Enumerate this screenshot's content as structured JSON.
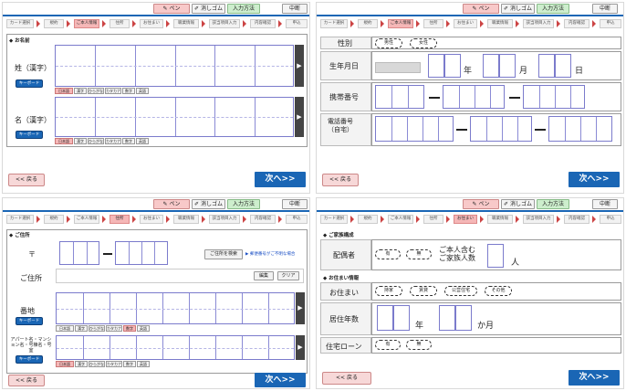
{
  "toolbar": {
    "pen": "ペン",
    "eraser": "消しゴム",
    "input_method": "入力方法",
    "stop": "中断"
  },
  "steps": [
    "カード選択",
    "規約",
    "ご本人情報",
    "住所",
    "お住まい",
    "職業情報",
    "該当項目入力",
    "内容確認",
    "申込"
  ],
  "nav": {
    "back": "<< 戻る",
    "next": "次へ>>"
  },
  "modes": [
    "日本語",
    "漢字",
    "ひらがな",
    "カタカナ",
    "数字",
    "英語"
  ],
  "keyboard": "キーボード",
  "p1": {
    "section": "お名前",
    "sei": "姓（漢字）",
    "mei": "名（漢字）",
    "active_step": 2,
    "active_mode": 0
  },
  "p2": {
    "gender_label": "性別",
    "male": "男性",
    "female": "女性",
    "birth_label": "生年月日",
    "year": "年",
    "month": "月",
    "day": "日",
    "mobile_label": "携帯番号",
    "phone_label": "電話番号\n（自宅）",
    "active_step": 2
  },
  "p3": {
    "section": "ご住所",
    "postal_mark": "〒",
    "search_btn": "ご住所を検索",
    "unknown_link": "郵便番号がご不明な場合",
    "address_label": "ご住所",
    "edit": "編集",
    "clear": "クリア",
    "banchi": "番地",
    "building": "アパート名・マンション名・号棟名・号室",
    "active_step": 3,
    "active_mode": 4
  },
  "p4": {
    "section1": "ご家族構成",
    "spouse": "配偶者",
    "yes": "有",
    "no": "無",
    "family_count": "ご本人含む\nご家族人数",
    "people": "人",
    "section2": "お住まい情報",
    "residence": "お住まい",
    "opts": [
      "持家",
      "賃貸",
      "公営住宅",
      "その他"
    ],
    "years_label": "居住年数",
    "years": "年",
    "months": "か月",
    "loan": "住宅ローン",
    "active_step": 4
  }
}
